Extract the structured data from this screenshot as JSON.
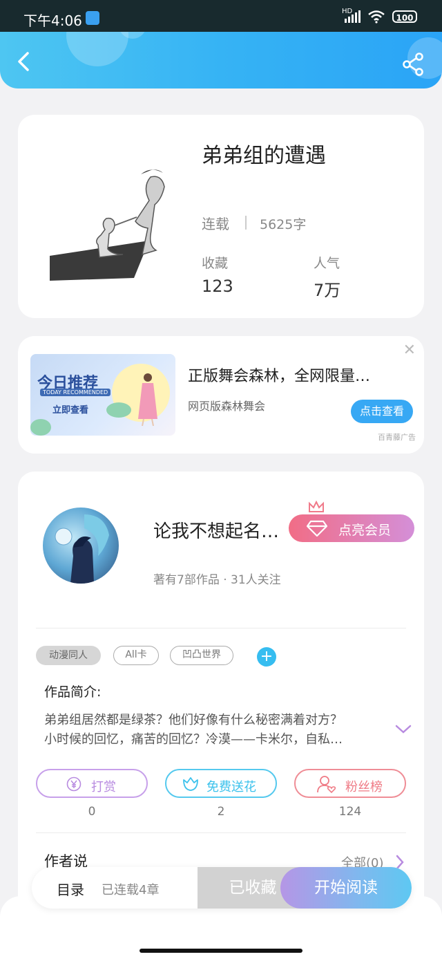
{
  "status_bar": {
    "time": "下午4:06",
    "network": "HD",
    "battery": "100"
  },
  "header": {
    "back_icon": "chevron-left-icon",
    "share_icon": "share-icon"
  },
  "book": {
    "title": "弟弟组的遭遇",
    "status": "连载",
    "word_count": "5625字",
    "stats": [
      {
        "label": "收藏",
        "value": "123"
      },
      {
        "label": "人气",
        "value": "7万"
      }
    ]
  },
  "ad": {
    "image_title": "今日推荐",
    "image_subtitle": "TODAY RECOMMENDED",
    "image_cta": "立即查看",
    "title": "正版舞会森林，全网限量…",
    "subtitle": "网页版森林舞会",
    "button": "点击查看",
    "source_tag": "百青藤广告"
  },
  "author": {
    "name": "论我不想起名…",
    "vip_button": "点亮会员",
    "meta": "著有7部作品 · 31人关注",
    "tags": [
      "动漫同人",
      "All卡",
      "凹凸世界"
    ],
    "add_tag": "+",
    "intro_label": "作品简介:",
    "intro_line1": "弟弟组居然都是绿茶？他们好像有什么秘密满着对方？",
    "intro_line2": "小时候的回忆，痛苦的回忆？冷漠——卡米尔，自私…",
    "actions": [
      {
        "label": "打赏",
        "count": "0",
        "color": "#b88be0"
      },
      {
        "label": "免费送花",
        "count": "2",
        "color": "#3cc2ec"
      },
      {
        "label": "粉丝榜",
        "count": "124",
        "color": "#ef7b86"
      }
    ],
    "author_says_label": "作者说",
    "all_link": "全部(0)"
  },
  "bottom_bar": {
    "toc": "目录",
    "toc_count": "已连载4章",
    "collect": "已收藏",
    "read": "开始阅读"
  }
}
